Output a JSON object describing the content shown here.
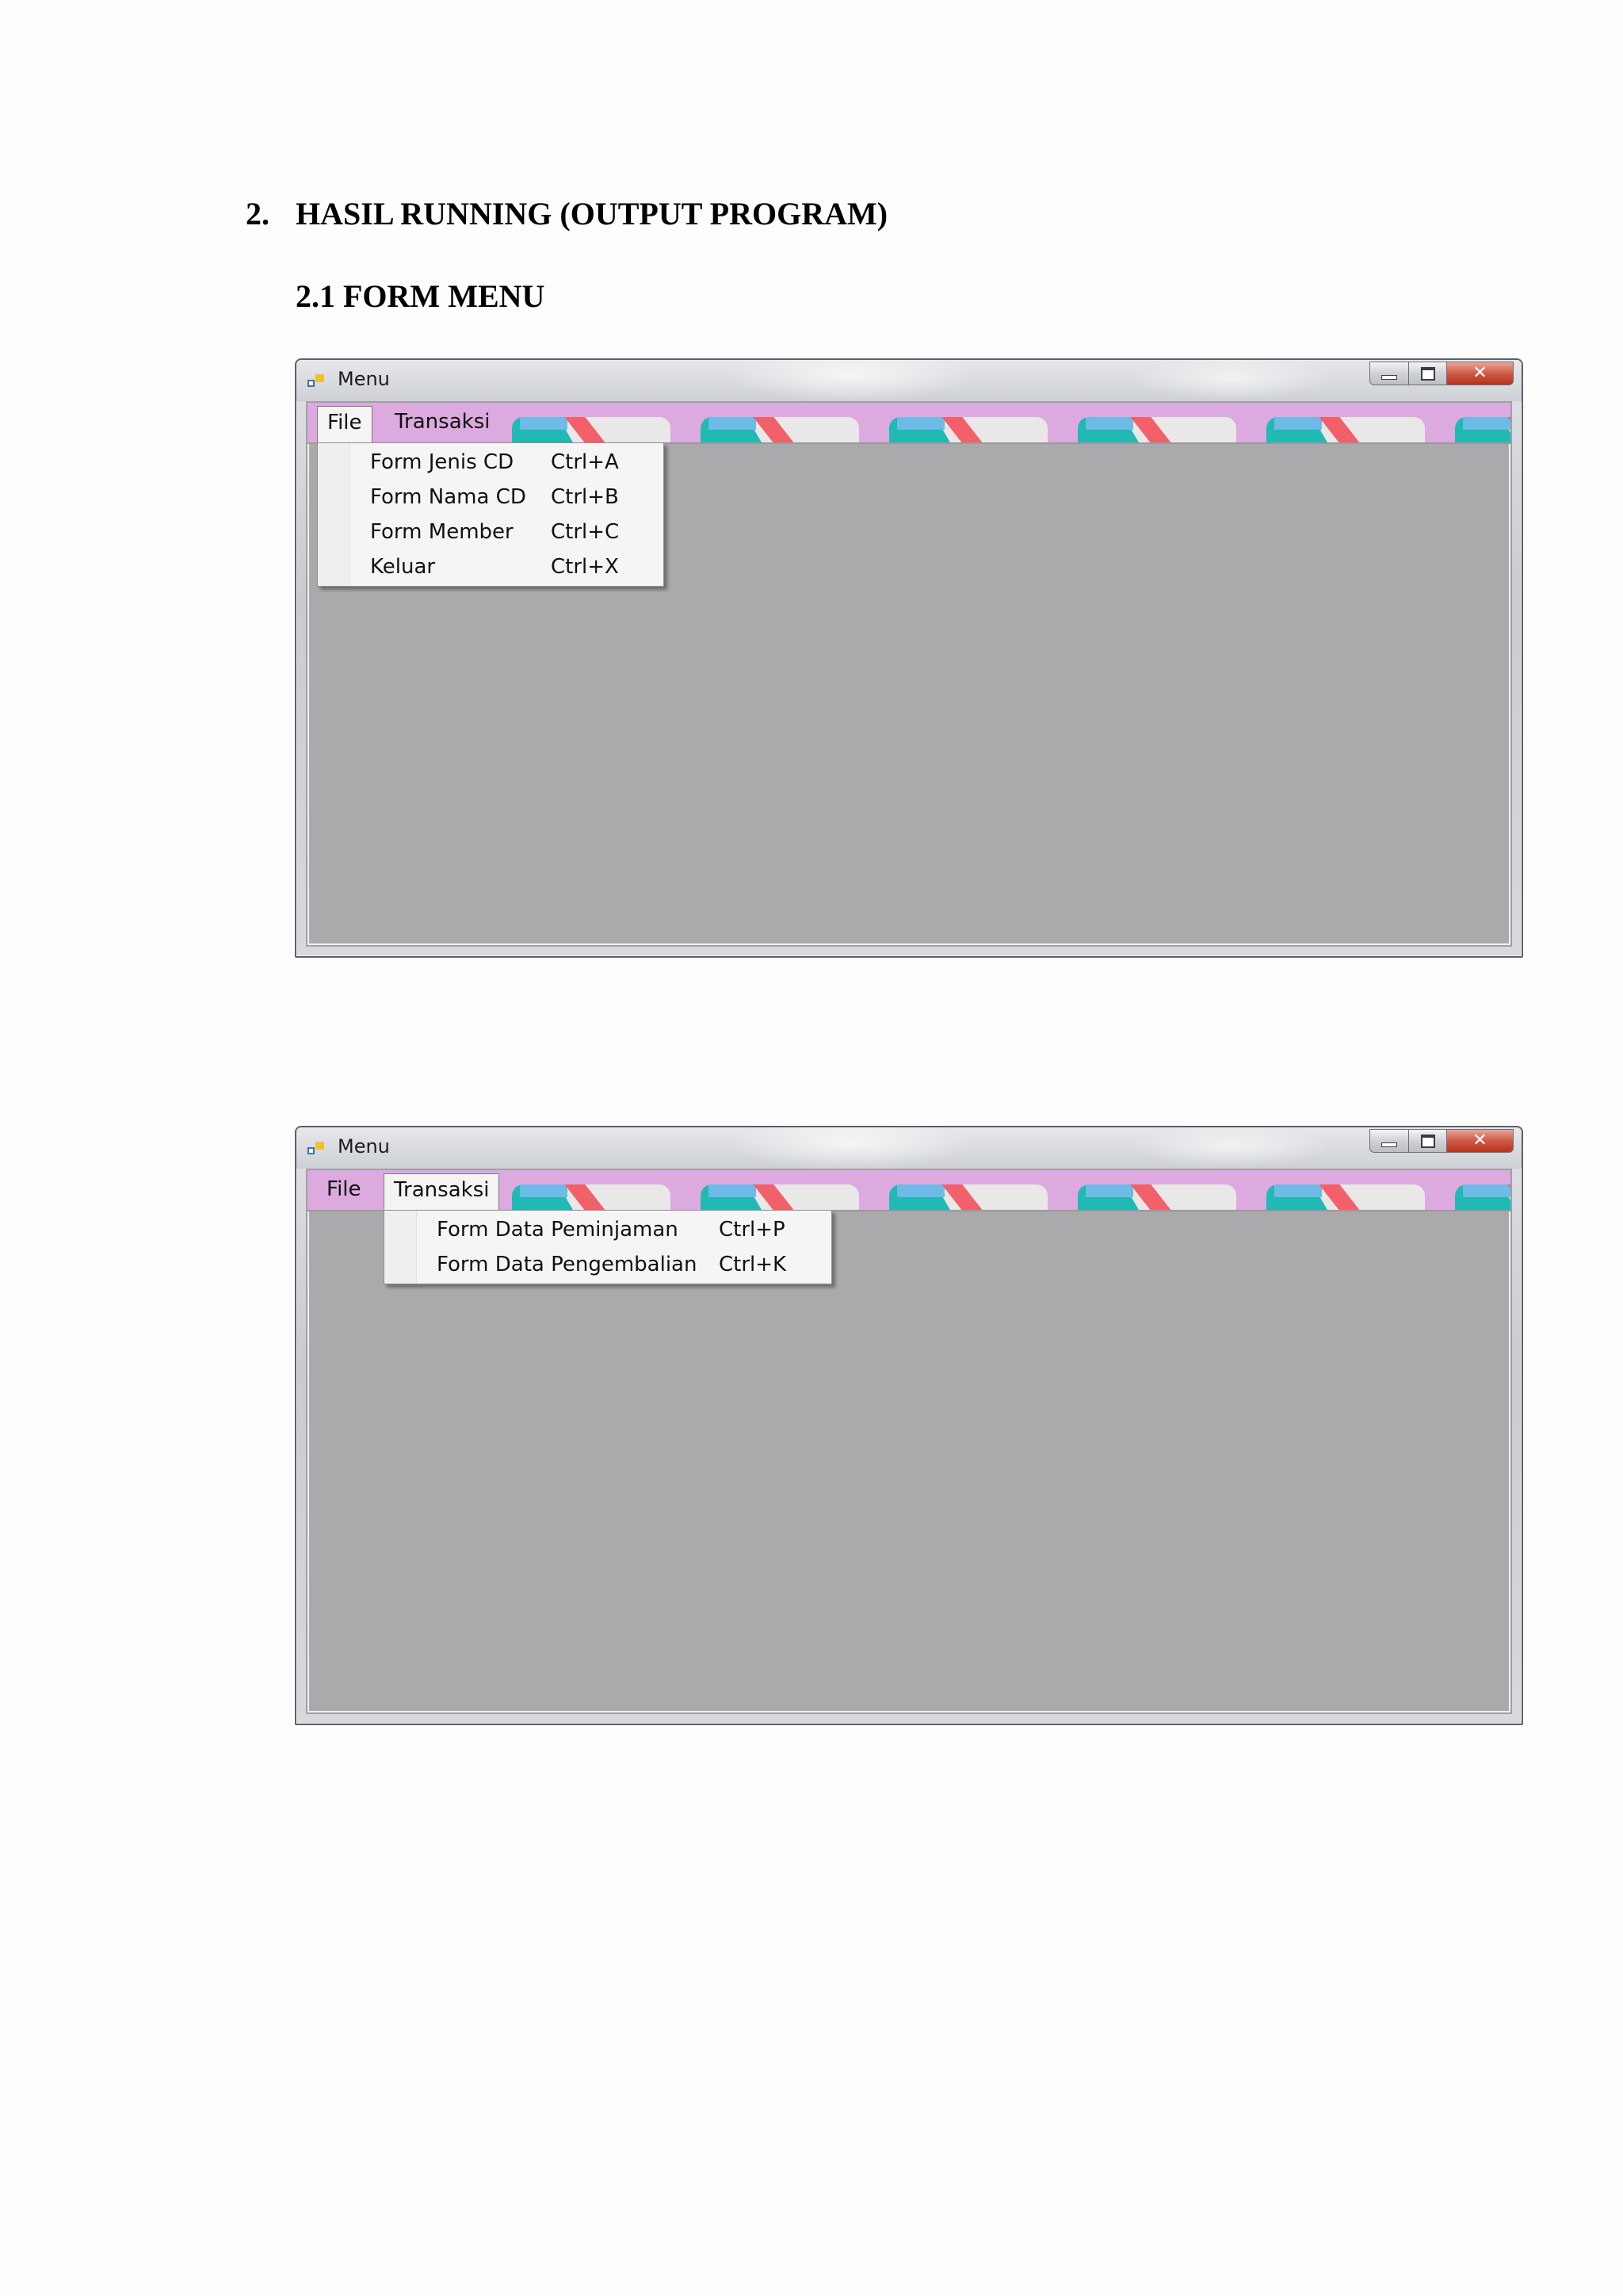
{
  "document": {
    "section_number": "2.",
    "section_title": "HASIL RUNNING (OUTPUT PROGRAM)",
    "subsection_title": "2.1 FORM MENU"
  },
  "windows": [
    {
      "title": "Menu",
      "menu": [
        "File",
        "Transaksi"
      ],
      "active_menu": "File",
      "dropdown": [
        {
          "label": "Form Jenis CD",
          "shortcut": "Ctrl+A"
        },
        {
          "label": "Form Nama CD",
          "shortcut": "Ctrl+B"
        },
        {
          "label": "Form Member",
          "shortcut": "Ctrl+C"
        },
        {
          "label": "Keluar",
          "shortcut": "Ctrl+X"
        }
      ]
    },
    {
      "title": "Menu",
      "menu": [
        "File",
        "Transaksi"
      ],
      "active_menu": "Transaksi",
      "dropdown": [
        {
          "label": "Form Data Peminjaman",
          "shortcut": "Ctrl+P"
        },
        {
          "label": "Form Data Pengembalian",
          "shortcut": "Ctrl+K"
        }
      ]
    }
  ],
  "icons": [
    "app-icon",
    "minimize-icon",
    "maximize-icon",
    "close-icon"
  ],
  "colors": {
    "client_background": "#aaa9ab",
    "menubar_background": "#dcaadf",
    "tile_teal": "#21b9b3",
    "tile_red": "#f2606a",
    "tile_blue": "#6dbbe6"
  }
}
